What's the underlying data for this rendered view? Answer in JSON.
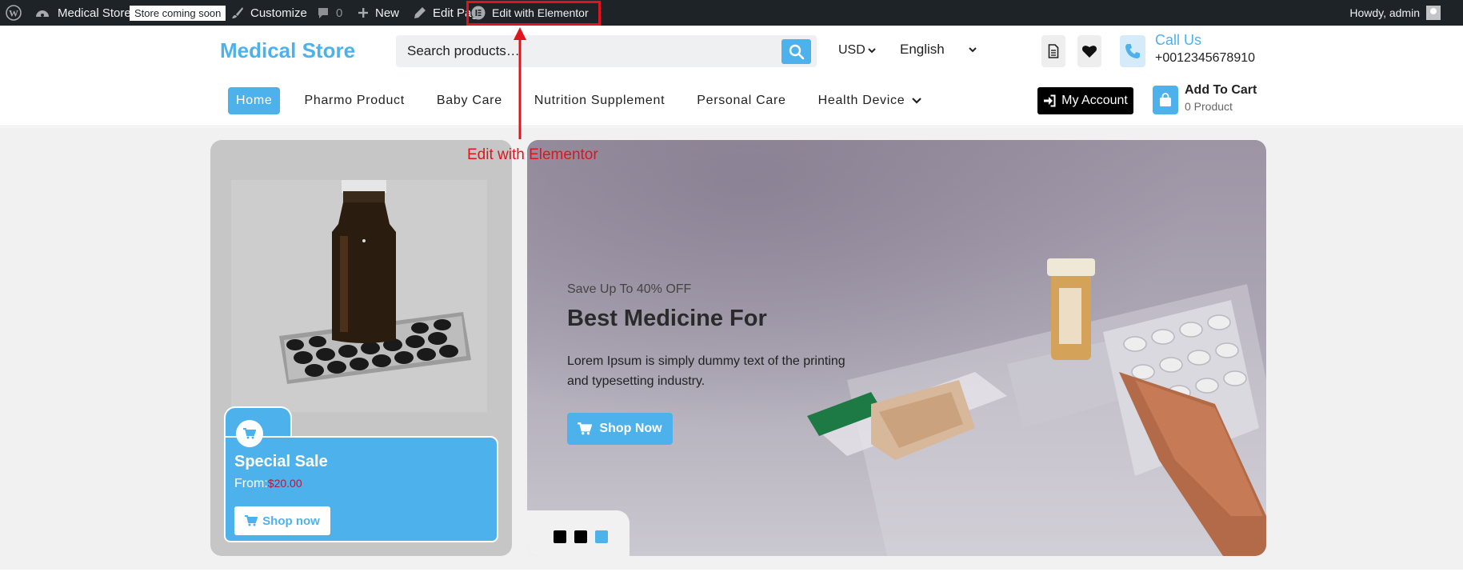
{
  "admin_bar": {
    "site_name": "Medical Store",
    "badge": "Store coming soon",
    "customize": "Customize",
    "comments_count": "0",
    "new": "New",
    "edit_page": "Edit Page",
    "edit_elementor": "Edit with Elementor",
    "greeting": "Howdy, admin"
  },
  "header": {
    "logo": "Medical Store",
    "search_placeholder": "Search products…",
    "currency": "USD",
    "language": "English",
    "call_label": "Call Us",
    "call_number": "+0012345678910"
  },
  "nav": {
    "items": [
      {
        "label": "Home",
        "active": true
      },
      {
        "label": "Pharmo Product"
      },
      {
        "label": "Baby Care"
      },
      {
        "label": "Nutrition Supplement"
      },
      {
        "label": "Personal Care"
      },
      {
        "label": "Health Device"
      }
    ],
    "account": "My Account",
    "cart_title": "Add To Cart",
    "cart_count": "0 Product"
  },
  "sale_card": {
    "title": "Special Sale",
    "from_label": "From:",
    "price": "$20.00",
    "button": "Shop now"
  },
  "hero": {
    "eyebrow": "Save Up To 40% OFF",
    "title": "Best Medicine For",
    "text": "Lorem Ipsum is simply dummy text of the printing and typesetting industry.",
    "button": "Shop Now",
    "slides": 3,
    "active_slide": 3
  },
  "annotation": "Edit with Elementor",
  "colors": {
    "accent": "#4db2ec",
    "admin_bar": "#1d2327",
    "annotation": "#e0141d",
    "price": "#b3173f"
  }
}
